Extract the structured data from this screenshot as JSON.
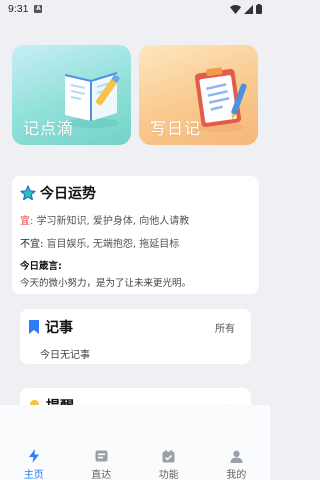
{
  "status_bar": {
    "time": "9:31",
    "notif_badge": "A"
  },
  "top_cards": [
    {
      "label": "记点滴",
      "icon": "book-pencil-illustration"
    },
    {
      "label": "写日记",
      "icon": "clipboard-pencil-illustration"
    }
  ],
  "fortune": {
    "title": "今日运势",
    "good_label": "宜:",
    "good_text": "学习新知识, 爱护身体, 向他人请教",
    "bad_label": "不宜:",
    "bad_text": "盲目娱乐, 无端抱怨, 拖延目标",
    "motto_label": "今日箴言:",
    "motto_text": "今天的微小努力，是为了让未来更光明。"
  },
  "notes": {
    "title": "记事",
    "all_label": "所有",
    "empty_text": "今日无记事"
  },
  "reminder": {
    "title": "提醒",
    "more": "···"
  },
  "bottom_nav": [
    {
      "label": "主页",
      "icon": "lightning-icon",
      "active": true
    },
    {
      "label": "直达",
      "icon": "card-icon",
      "active": false
    },
    {
      "label": "功能",
      "icon": "calendar-check-icon",
      "active": false
    },
    {
      "label": "我的",
      "icon": "person-icon",
      "active": false
    }
  ],
  "colors": {
    "accent": "#2d7cf6",
    "good": "#dd3333",
    "note_card": "#8fe0d9",
    "diary_card": "#f9c98e",
    "star": "#29c6b6"
  }
}
